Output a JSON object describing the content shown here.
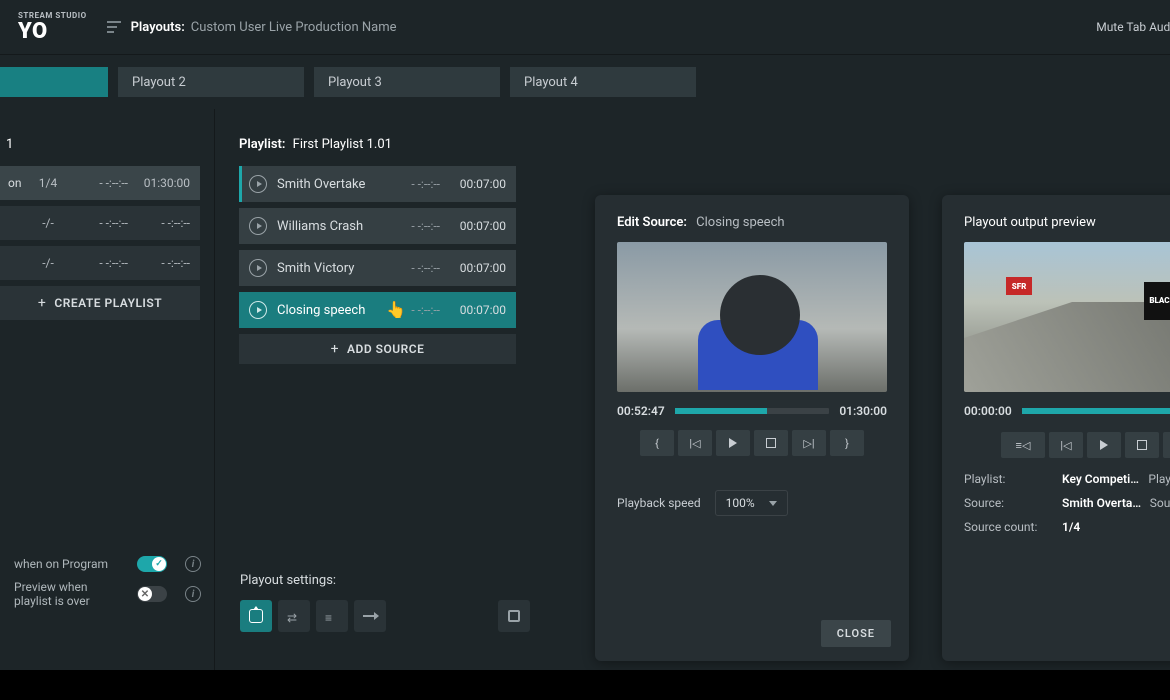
{
  "header": {
    "brand_small": "STREAM STUDIO",
    "brand_big": "YO",
    "playouts_label": "Playouts:",
    "production_name": "Custom User Live Production Name",
    "mute_label": "Mute Tab Audio"
  },
  "tabs": [
    {
      "label": "",
      "active": true
    },
    {
      "label": "Playout 2",
      "active": false
    },
    {
      "label": "Playout 3",
      "active": false
    },
    {
      "label": "Playout 4",
      "active": false
    }
  ],
  "sidebar": {
    "header_num": "1",
    "playlists": [
      {
        "name": "on Moments",
        "count": "1/4",
        "start": "- -:--:--",
        "dur": "01:30:00",
        "active": true
      },
      {
        "name": "",
        "count": "-/-",
        "start": "- -:--:--",
        "dur": "- -:--:--",
        "active": false
      },
      {
        "name": "",
        "count": "-/-",
        "start": "- -:--:--",
        "dur": "- -:--:--",
        "active": false
      }
    ],
    "create_label": "CREATE PLAYLIST"
  },
  "sources": {
    "title_label": "Playlist:",
    "title_value": "First Playlist 1.01",
    "items": [
      {
        "name": "Smith Overtake",
        "t": "- -:--:--",
        "dur": "00:07:00",
        "first": true,
        "sel": false
      },
      {
        "name": "Williams Crash",
        "t": "- -:--:--",
        "dur": "00:07:00",
        "first": false,
        "sel": false
      },
      {
        "name": "Smith Victory",
        "t": "- -:--:--",
        "dur": "00:07:00",
        "first": false,
        "sel": false
      },
      {
        "name": "Closing speech",
        "t": "- -:--:--",
        "dur": "00:07:00",
        "first": false,
        "sel": true
      }
    ],
    "add_label": "ADD SOURCE"
  },
  "options": {
    "when_program": "when on Program",
    "preview_over": "Preview when playlist is over"
  },
  "playout_settings": {
    "title": "Playout settings:"
  },
  "edit": {
    "title_label": "Edit Source:",
    "title_value": "Closing speech",
    "current": "00:52:47",
    "total": "01:30:00",
    "progress_pct": 60,
    "speed_label": "Playback speed",
    "speed_value": "100%",
    "close": "CLOSE"
  },
  "output": {
    "title": "Playout output preview",
    "current": "00:00:00",
    "progress_pct": 100,
    "playlist_label": "Playlist:",
    "playlist_value": "Key Competition...",
    "playlist_right": "Playlist time left",
    "source_label": "Source:",
    "source_value": "Smith Overtake",
    "source_right": "Source time left",
    "count_label": "Source count:",
    "count_value": "1/4",
    "sign1": "BLACK+\nDECKER",
    "sign2": "SFR"
  }
}
